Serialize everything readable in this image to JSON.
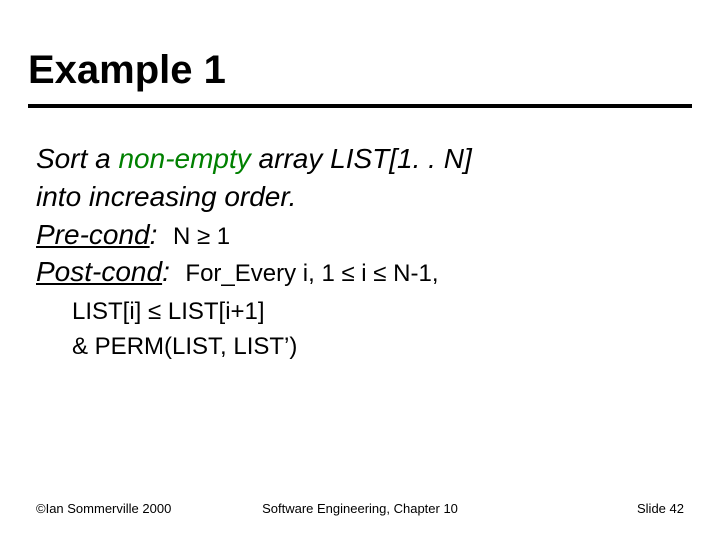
{
  "title": "Example 1",
  "body": {
    "line1_a": "Sort a ",
    "line1_b": "non-empty",
    "line1_c": " array LIST[1. . N]",
    "line2": "into increasing order.",
    "precond_label": "Pre-cond",
    "precond_colon": ":  ",
    "precond_value": "N ≥ 1",
    "postcond_label": "Post-cond",
    "postcond_colon": ":  ",
    "postcond_value": "For_Every i, 1 ≤ i ≤ N-1,",
    "tail1": "LIST[i] ≤ LIST[i+1]",
    "tail2": "& PERM(LIST, LIST’)"
  },
  "footer": {
    "left": "©Ian Sommerville 2000",
    "center": "Software Engineering, Chapter 10",
    "right_label": "Slide ",
    "right_num": "42"
  }
}
